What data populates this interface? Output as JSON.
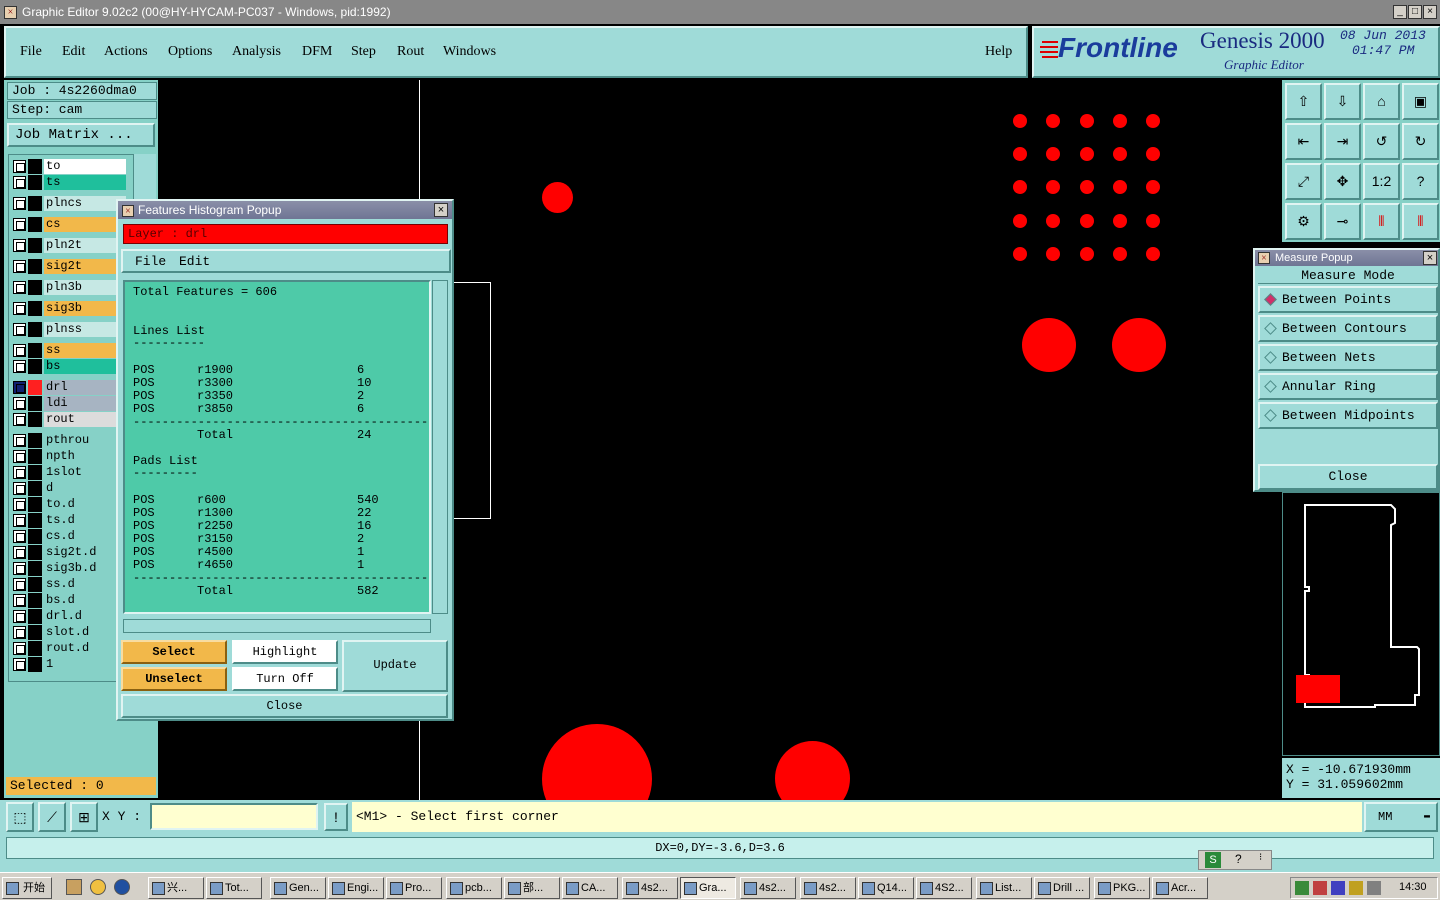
{
  "window": {
    "title": "Graphic Editor 9.02c2 (00@HY-HYCAM-PC037 - Windows, pid:1992)"
  },
  "menu": {
    "file": "File",
    "edit": "Edit",
    "actions": "Actions",
    "options": "Options",
    "analysis": "Analysis",
    "dfm": "DFM",
    "step": "Step",
    "rout": "Rout",
    "windows": "Windows",
    "help": "Help"
  },
  "brand": {
    "logo": "Frontline",
    "product": "Genesis 2000",
    "subtitle": "Graphic Editor",
    "date": "08 Jun 2013",
    "time": "01:47 PM"
  },
  "left": {
    "job": "Job : 4s2260dma0",
    "step": "Step: cam",
    "job_matrix": "Job Matrix ...",
    "selected": "Selected : 0",
    "layers": [
      {
        "name": "to",
        "color": "#ffffff"
      },
      {
        "name": "ts",
        "color": "#1fbf9c"
      },
      {
        "name": "plncs",
        "color": "#c6e8e4"
      },
      {
        "name": "cs",
        "color": "#f2b84a"
      },
      {
        "name": "pln2t",
        "color": "#c6e8e4"
      },
      {
        "name": "sig2t",
        "color": "#f2b84a"
      },
      {
        "name": "pln3b",
        "color": "#c6e8e4"
      },
      {
        "name": "sig3b",
        "color": "#f2b84a"
      },
      {
        "name": "plnss",
        "color": "#c6e8e4"
      },
      {
        "name": "ss",
        "color": "#f2b84a"
      },
      {
        "name": "bs",
        "color": "#1fbf9c"
      },
      {
        "name": "drl",
        "color": "#a7b4c2"
      },
      {
        "name": "ldi",
        "color": "#a7b4c2"
      },
      {
        "name": "rout",
        "color": "#dcdcdc"
      },
      {
        "name": "pthrou",
        "color": "#86d1c7"
      },
      {
        "name": "npth",
        "color": "#86d1c7"
      },
      {
        "name": "1slot",
        "color": "#86d1c7"
      },
      {
        "name": "d",
        "color": "#86d1c7"
      },
      {
        "name": "to.d",
        "color": "#86d1c7"
      },
      {
        "name": "ts.d",
        "color": "#86d1c7"
      },
      {
        "name": "cs.d",
        "color": "#86d1c7"
      },
      {
        "name": "sig2t.d",
        "color": "#86d1c7"
      },
      {
        "name": "sig3b.d",
        "color": "#86d1c7"
      },
      {
        "name": "ss.d",
        "color": "#86d1c7"
      },
      {
        "name": "bs.d",
        "color": "#86d1c7"
      },
      {
        "name": "drl.d",
        "color": "#86d1c7"
      },
      {
        "name": "slot.d",
        "color": "#86d1c7"
      },
      {
        "name": "rout.d",
        "color": "#86d1c7"
      },
      {
        "name": "1",
        "color": "#86d1c7"
      }
    ]
  },
  "histogram": {
    "title": "Features Histogram Popup",
    "layer": "Layer :  drl",
    "menu_file": "File",
    "menu_edit": "Edit",
    "total_features": "Total Features = 606",
    "lines_header": "Lines List",
    "underline_lines": "----------",
    "lines": [
      {
        "pol": "POS",
        "sym": "r1900",
        "count": "6"
      },
      {
        "pol": "POS",
        "sym": "r3300",
        "count": "10"
      },
      {
        "pol": "POS",
        "sym": "r3350",
        "count": "2"
      },
      {
        "pol": "POS",
        "sym": "r3850",
        "count": "6"
      }
    ],
    "separator": "-----------------------------------------",
    "lines_total_label": "Total",
    "lines_total": "24",
    "pads_header": "Pads List",
    "underline_pads": "---------",
    "pads": [
      {
        "pol": "POS",
        "sym": "r600",
        "count": "540"
      },
      {
        "pol": "POS",
        "sym": "r1300",
        "count": "22"
      },
      {
        "pol": "POS",
        "sym": "r2250",
        "count": "16"
      },
      {
        "pol": "POS",
        "sym": "r3150",
        "count": "2"
      },
      {
        "pol": "POS",
        "sym": "r4500",
        "count": "1"
      },
      {
        "pol": "POS",
        "sym": "r4650",
        "count": "1"
      }
    ],
    "pads_total_label": "Total",
    "pads_total": "582",
    "btn_select": "Select",
    "btn_highlight": "Highlight",
    "btn_update": "Update",
    "btn_unselect": "Unselect",
    "btn_turnoff": "Turn Off",
    "btn_close": "Close"
  },
  "measure": {
    "title": "Measure Popup",
    "mode_label": "Measure Mode",
    "options": [
      "Between Points",
      "Between Contours",
      "Between Nets",
      "Annular Ring",
      "Between Midpoints"
    ],
    "selected": "Between Points",
    "close": "Close"
  },
  "toolbar_icons": [
    "zoom-home-icon",
    "zoom-in-icon",
    "home-icon",
    "window-icon",
    "pan-left-icon",
    "pan-right-icon",
    "undo-zoom-icon",
    "redraw-icon",
    "fit-icon",
    "zoom-center-icon",
    "one-to-one-icon",
    "help-icon",
    "tools-icon",
    "snap-icon",
    "layers-display-icon",
    "layers-select-icon"
  ],
  "toolbar_labels": {
    "one_to_one": "1:2",
    "help": "?"
  },
  "coords": {
    "x": "X = -10.671930mm",
    "y": "Y = 31.059602mm"
  },
  "status": {
    "xy_label": "X Y :",
    "xy_value": "",
    "prompt": "<M1> - Select first corner",
    "units": "MM",
    "delta": "DX=0,DY=-3.6,D=3.6"
  },
  "taskbar": {
    "start": "开始",
    "clock": "14:30",
    "tasks": [
      "兴...",
      "Tot...",
      "Gen...",
      "Engi...",
      "Pro...",
      "pcb...",
      "部...",
      "CA...",
      "4s2...",
      "Gra...",
      "4s2...",
      "4s2...",
      "Q14...",
      "4S2...",
      "List...",
      "Drill ...",
      "PKG...",
      "Acr..."
    ]
  },
  "colors": {
    "panel": "#9fdbd8",
    "feature": "#ff0000",
    "layer_bar": "#ff0000",
    "background": "#000000"
  }
}
